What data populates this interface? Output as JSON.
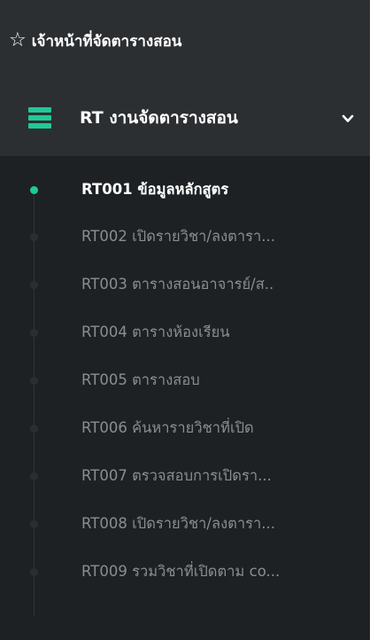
{
  "header": {
    "star_icon": "star-outline-icon",
    "title": "เจ้าหน้าที่จัดตารางสอน"
  },
  "group": {
    "icon": "list-icon",
    "label": "RT งานจัดตารางสอน",
    "chevron_icon": "chevron-down-icon",
    "accent": "#20c997"
  },
  "items": [
    {
      "label": "RT001 ข้อมูลหลักสูตร",
      "active": true
    },
    {
      "label": "RT002 เปิดรายวิชา/ลงตารา...",
      "active": false
    },
    {
      "label": "RT003 ตารางสอนอาจารย์/ส..",
      "active": false
    },
    {
      "label": "RT004 ตารางห้องเรียน",
      "active": false
    },
    {
      "label": "RT005 ตารางสอบ",
      "active": false
    },
    {
      "label": "RT006 ค้นหารายวิชาที่เปิด",
      "active": false
    },
    {
      "label": "RT007 ตรวจสอบการเปิดรา...",
      "active": false
    },
    {
      "label": "RT008 เปิดรายวิชา/ลงตารา...",
      "active": false
    },
    {
      "label": "RT009 รวมวิชาที่เปิดตาม co...",
      "active": false
    }
  ]
}
